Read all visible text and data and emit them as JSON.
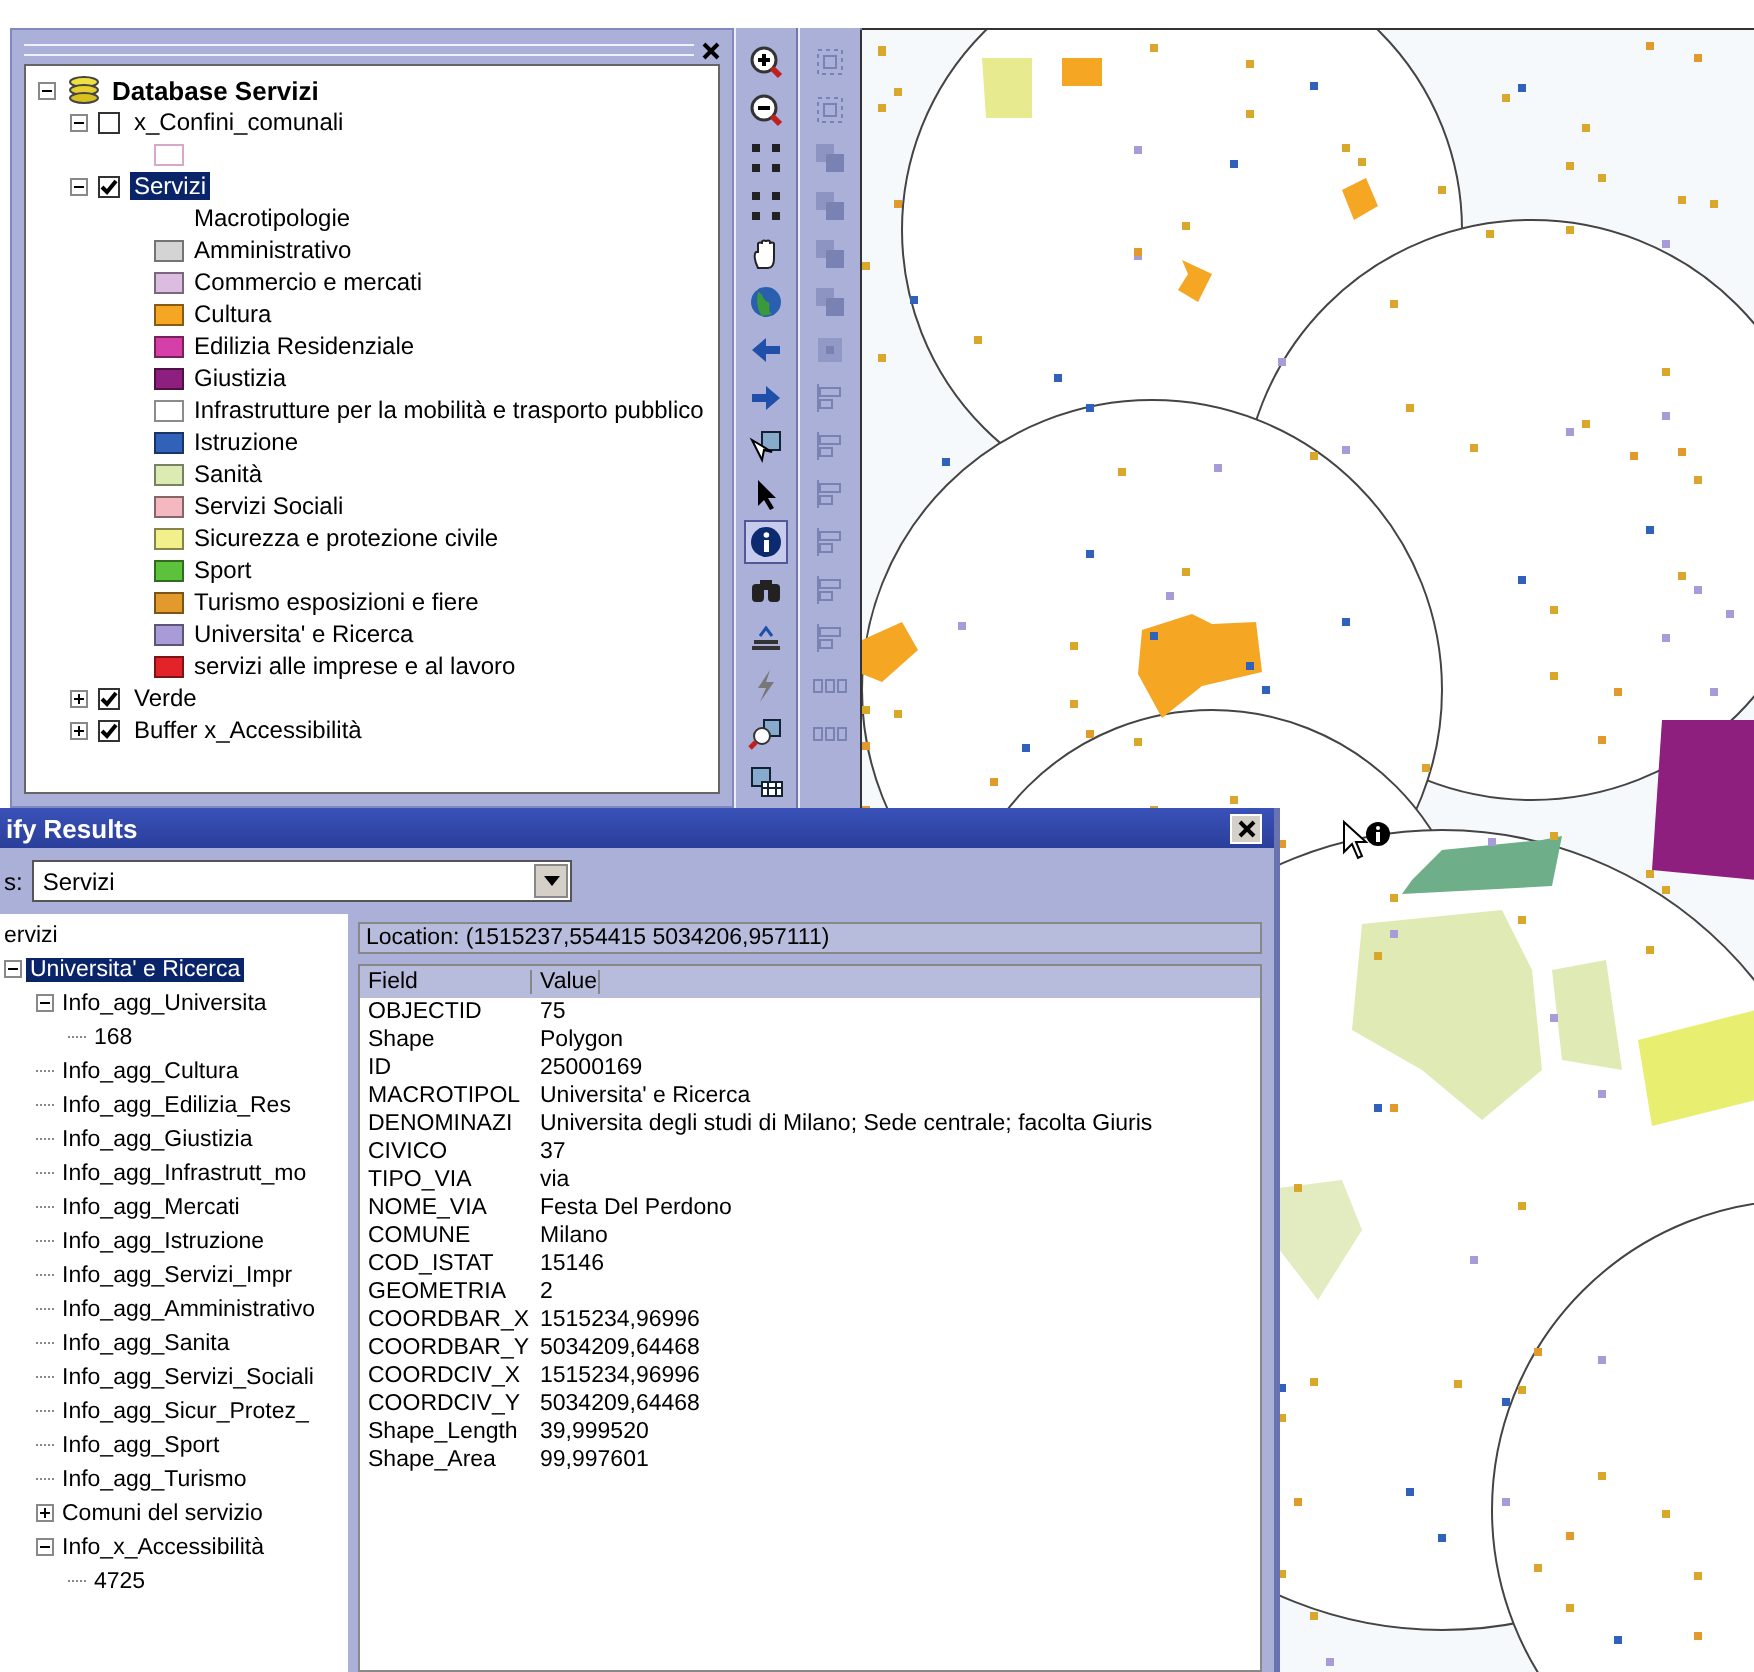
{
  "toc": {
    "root": {
      "label": "Database Servizi",
      "expanded": true
    },
    "layers": [
      {
        "label": "x_Confini_comunali",
        "checked": false,
        "expanded": true,
        "selected": false,
        "symbol": {
          "color": "#d8a8c8"
        }
      },
      {
        "label": "Servizi",
        "checked": true,
        "expanded": true,
        "selected": true,
        "heading": "Macrotipologie",
        "classes": [
          {
            "label": "Amministrativo",
            "color": "#d4d4d4"
          },
          {
            "label": "Commercio e mercati",
            "color": "#dcbce0"
          },
          {
            "label": "Cultura",
            "color": "#f5a623"
          },
          {
            "label": "Edilizia Residenziale",
            "color": "#d63fa8"
          },
          {
            "label": "Giustizia",
            "color": "#8e1f7e"
          },
          {
            "label": "Infrastrutture per la mobilità e trasporto pubblico",
            "color": "#ffffff"
          },
          {
            "label": "Istruzione",
            "color": "#2f62b8"
          },
          {
            "label": "Sanità",
            "color": "#dcebb4"
          },
          {
            "label": "Servizi Sociali",
            "color": "#f4b8c0"
          },
          {
            "label": "Sicurezza e protezione civile",
            "color": "#f2f08a"
          },
          {
            "label": "Sport",
            "color": "#5cc23c"
          },
          {
            "label": "Turismo esposizioni e fiere",
            "color": "#e39a2c"
          },
          {
            "label": "Universita' e Ricerca",
            "color": "#a99ad8"
          },
          {
            "label": "servizi alle imprese e al lavoro",
            "color": "#e2232a"
          }
        ]
      },
      {
        "label": "Verde",
        "checked": true,
        "expanded": false,
        "selected": false
      },
      {
        "label": "Buffer x_Accessibilità",
        "checked": true,
        "expanded": false,
        "selected": false
      }
    ]
  },
  "tools": [
    {
      "kind": "zoom-in",
      "selected": false
    },
    {
      "kind": "zoom-out",
      "selected": false
    },
    {
      "kind": "fixed-zoom-in",
      "selected": false
    },
    {
      "kind": "fixed-zoom-out",
      "selected": false
    },
    {
      "kind": "pan",
      "selected": false
    },
    {
      "kind": "globe",
      "selected": false
    },
    {
      "kind": "back",
      "selected": false
    },
    {
      "kind": "forward",
      "selected": false
    },
    {
      "kind": "select-features",
      "selected": false
    },
    {
      "kind": "pointer",
      "selected": false
    },
    {
      "kind": "info",
      "selected": true
    },
    {
      "kind": "find",
      "selected": false
    },
    {
      "kind": "measure",
      "selected": false
    },
    {
      "kind": "lightning",
      "selected": false
    },
    {
      "kind": "zoom-selected",
      "selected": false
    },
    {
      "kind": "table",
      "selected": false
    }
  ],
  "layout_tools": [
    {
      "kind": "frame",
      "disabled": true
    },
    {
      "kind": "frame",
      "disabled": true
    },
    {
      "kind": "stack",
      "disabled": true
    },
    {
      "kind": "stack",
      "disabled": true
    },
    {
      "kind": "stack",
      "disabled": true
    },
    {
      "kind": "stack",
      "disabled": true
    },
    {
      "kind": "square",
      "disabled": true
    },
    {
      "kind": "align",
      "disabled": true
    },
    {
      "kind": "align",
      "disabled": true
    },
    {
      "kind": "align",
      "disabled": true
    },
    {
      "kind": "align",
      "disabled": true
    },
    {
      "kind": "align",
      "disabled": true
    },
    {
      "kind": "align",
      "disabled": true
    },
    {
      "kind": "distribute",
      "disabled": true
    },
    {
      "kind": "distribute",
      "disabled": true
    }
  ],
  "identify": {
    "title": "ify Results",
    "layers_label": "s:",
    "layer_value": "Servizi",
    "tree": {
      "label": "ervizi",
      "children": [
        {
          "label": "Universita' e Ricerca",
          "selected": true,
          "expanded": true,
          "children": [
            {
              "label": "Info_agg_Universita",
              "selected": false,
              "expanded": true,
              "children": [
                {
                  "label": "168",
                  "selected": false
                }
              ]
            },
            {
              "label": "Info_agg_Cultura",
              "selected": false
            },
            {
              "label": "Info_agg_Edilizia_Res",
              "selected": false
            },
            {
              "label": "Info_agg_Giustizia",
              "selected": false
            },
            {
              "label": "Info_agg_Infrastrutt_mo",
              "selected": false
            },
            {
              "label": "Info_agg_Mercati",
              "selected": false
            },
            {
              "label": "Info_agg_Istruzione",
              "selected": false
            },
            {
              "label": "Info_agg_Servizi_Impr",
              "selected": false
            },
            {
              "label": "Info_agg_Amministrativo",
              "selected": false
            },
            {
              "label": "Info_agg_Sanita",
              "selected": false
            },
            {
              "label": "Info_agg_Servizi_Sociali",
              "selected": false
            },
            {
              "label": "Info_agg_Sicur_Protez_",
              "selected": false
            },
            {
              "label": "Info_agg_Sport",
              "selected": false
            },
            {
              "label": "Info_agg_Turismo",
              "selected": false
            },
            {
              "label": "Comuni del servizio",
              "selected": false,
              "expanded": false
            },
            {
              "label": "Info_x_Accessibilità",
              "selected": false,
              "expanded": true,
              "children": [
                {
                  "label": "4725",
                  "selected": false
                }
              ]
            }
          ]
        }
      ]
    },
    "location": "Location: (1515237,554415 5034206,957111)",
    "columns": [
      "Field",
      "Value"
    ],
    "rows": [
      [
        "OBJECTID",
        "75"
      ],
      [
        "Shape",
        "Polygon"
      ],
      [
        "ID",
        "25000169"
      ],
      [
        "MACROTIPOL",
        "Universita' e Ricerca"
      ],
      [
        "DENOMINAZI",
        "Universita degli studi di Milano; Sede centrale; facolta Giuris"
      ],
      [
        "CIVICO",
        "37"
      ],
      [
        "TIPO_VIA",
        "via"
      ],
      [
        "NOME_VIA",
        "Festa Del Perdono"
      ],
      [
        "COMUNE",
        "Milano"
      ],
      [
        "COD_ISTAT",
        "15146"
      ],
      [
        "GEOMETRIA",
        "2"
      ],
      [
        "COORDBAR_X",
        "1515234,96996"
      ],
      [
        "COORDBAR_Y",
        "5034209,64468"
      ],
      [
        "COORDCIV_X",
        "1515234,96996"
      ],
      [
        "COORDCIV_Y",
        "5034209,64468"
      ],
      [
        "Shape_Length",
        "39,999520"
      ],
      [
        "Shape_Area",
        "99,997601"
      ]
    ]
  }
}
